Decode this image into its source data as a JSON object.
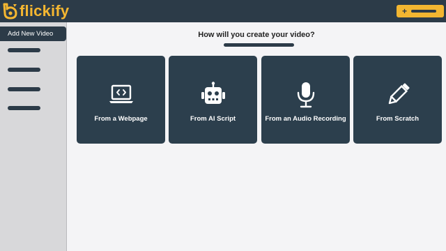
{
  "app": {
    "name": "flickify"
  },
  "header": {
    "new_button_icon": "plus-icon"
  },
  "sidebar": {
    "active_item": "Add New Video",
    "placeholder_items": 4
  },
  "main": {
    "prompt": "How will you create your video?",
    "options": [
      {
        "label": "From a Webpage",
        "icon": "laptop-code-icon"
      },
      {
        "label": "From AI Script",
        "icon": "robot-icon"
      },
      {
        "label": "From an Audio Recording",
        "icon": "microphone-icon"
      },
      {
        "label": "From Scratch",
        "icon": "pencil-icon"
      }
    ]
  },
  "colors": {
    "brand": "#f5b731",
    "header_bg": "#2c3b48",
    "card_bg": "#2c3f4d",
    "sidebar_bg": "#d8d8da",
    "page_bg": "#f4f4f6"
  }
}
